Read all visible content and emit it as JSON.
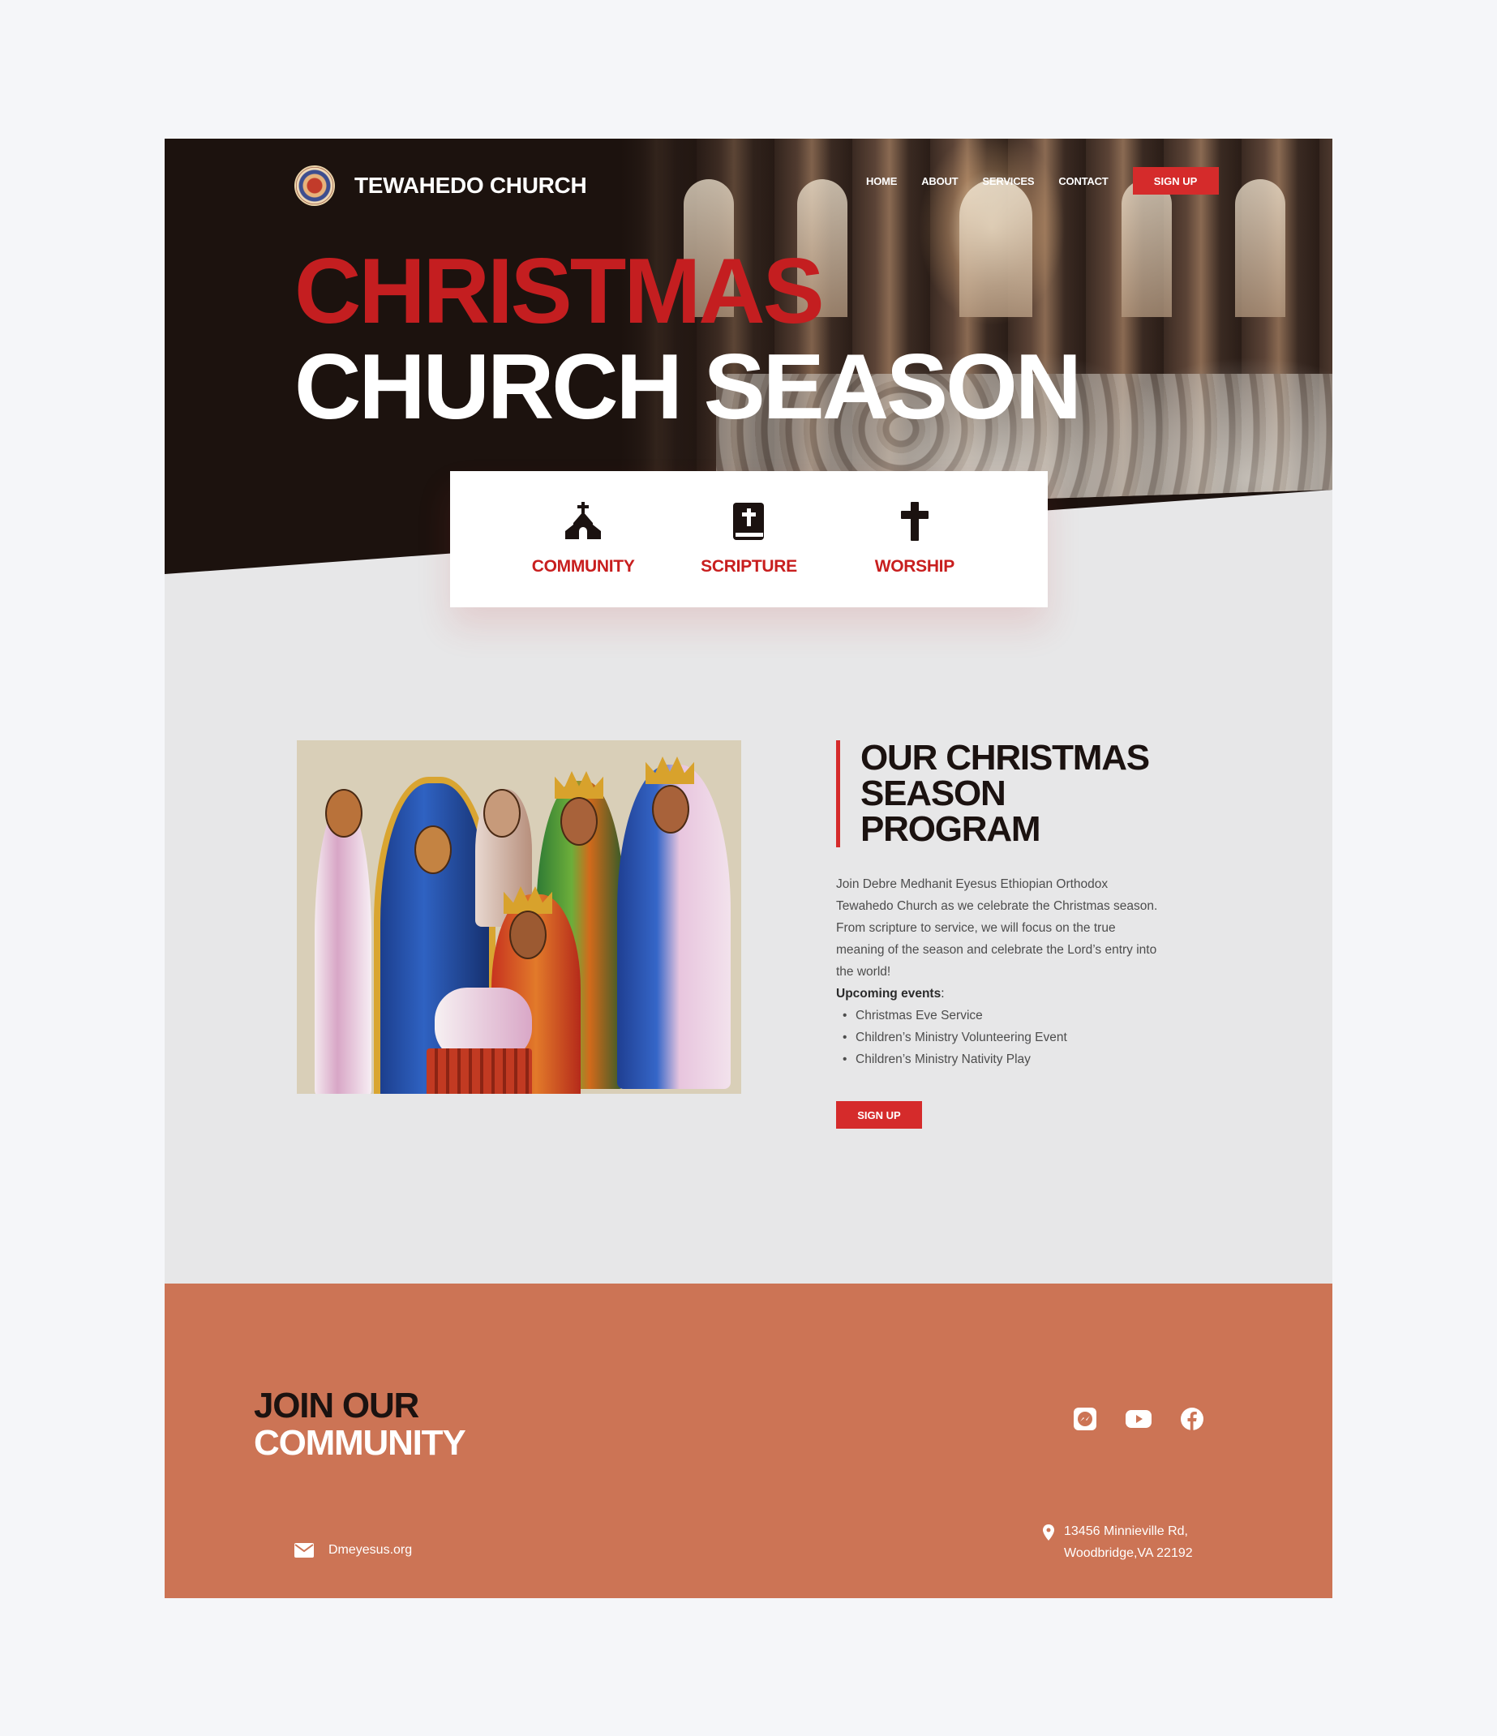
{
  "header": {
    "brand_name": "TEWAHEDO CHURCH",
    "nav": [
      "HOME",
      "ABOUT",
      "SERVICES",
      "CONTACT"
    ],
    "signup_label": "SIGN UP"
  },
  "hero": {
    "title_line1": "CHRISTMAS",
    "title_line2": "CHURCH SEASON"
  },
  "features": [
    {
      "label": "COMMUNITY",
      "icon": "church-icon"
    },
    {
      "label": "SCRIPTURE",
      "icon": "bible-icon"
    },
    {
      "label": "WORSHIP",
      "icon": "cross-icon"
    }
  ],
  "program": {
    "title_line1": "OUR CHRISTMAS",
    "title_line2": "SEASON PROGRAM",
    "description": "Join Debre Medhanit Eyesus Ethiopian Orthodox Tewahedo Church as we celebrate the Christmas season. From scripture to service, we will focus on the true meaning of the season and celebrate the Lord’s entry into the world!",
    "upcoming_label": "Upcoming events",
    "upcoming_colon": ":",
    "events": [
      "Christmas Eve Service",
      "Children’s Ministry Volunteering Event",
      "Children’s Ministry Nativity Play"
    ],
    "button_label": "SIGN UP"
  },
  "footer": {
    "join_line1": "JOIN OUR",
    "join_line2": "COMMUNITY",
    "socials": [
      "messenger-icon",
      "youtube-icon",
      "facebook-icon"
    ],
    "email": "Dmeyesus.org",
    "address_line1": "13456 Minnieville Rd,",
    "address_line2": "Woodbridge,VA 22192"
  },
  "colors": {
    "accent_red": "#d52b2b",
    "hero_dark": "#1c120e",
    "section_bg": "#e7e7e8",
    "footer_bg": "#cc7455",
    "page_bg": "#f5f6f9"
  }
}
